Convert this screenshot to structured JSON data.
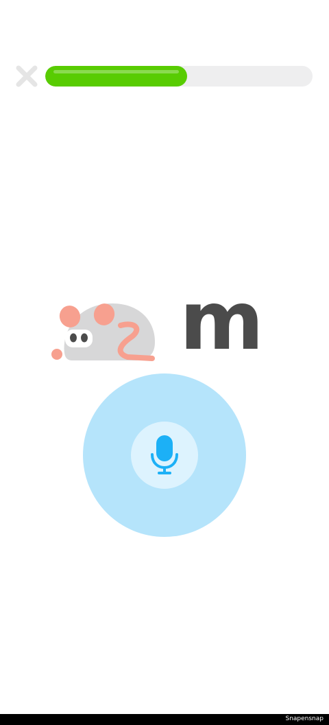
{
  "header": {
    "close_icon": "close-x-icon",
    "progress_fraction": 0.53
  },
  "exercise": {
    "illustration_icon": "mouse-icon",
    "letter": "m"
  },
  "mic": {
    "icon": "microphone-icon"
  },
  "footer": {
    "watermark": "Snapensnap"
  },
  "colors": {
    "progress": "#58cc02",
    "track": "#eeeeef",
    "mic_outer": "#b5e4fb",
    "mic_inner": "#ddf3fe",
    "mic_icon": "#1cb0f6",
    "letter": "#4b4b4b"
  }
}
